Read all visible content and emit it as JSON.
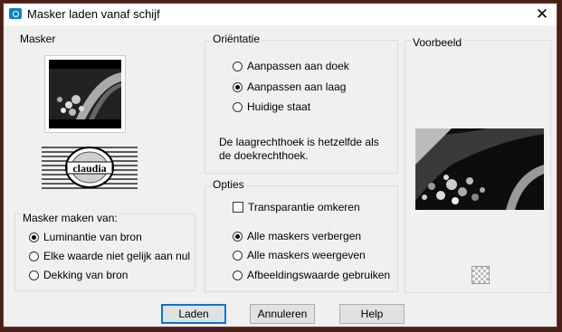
{
  "window": {
    "title": "Masker laden vanaf schijf",
    "close_label": "✕"
  },
  "masker": {
    "label": "Masker"
  },
  "bron": {
    "label": "Masker maken van:",
    "options": [
      "Luminantie van bron",
      "Elke waarde niet gelijk aan nul",
      "Dekking van bron"
    ],
    "selected": 0
  },
  "orientatie": {
    "label": "Oriëntatie",
    "options": [
      "Aanpassen aan doek",
      "Aanpassen aan laag",
      "Huidige staat"
    ],
    "selected": 1,
    "info": "De laagrechthoek is hetzelfde als de doekrechthoek."
  },
  "opties": {
    "label": "Opties",
    "checkbox_label": "Transparantie omkeren",
    "checkbox_checked": false,
    "options": [
      "Alle maskers verbergen",
      "Alle maskers weergeven",
      "Afbeeldingswaarde gebruiken"
    ],
    "selected": 0
  },
  "voorbeeld": {
    "label": "Voorbeeld"
  },
  "buttons": {
    "load": "Laden",
    "cancel": "Annuleren",
    "help": "Help"
  },
  "logo_text": "claudia",
  "colors": {
    "accent": "#0078d7",
    "frame": "#4a1f18"
  }
}
